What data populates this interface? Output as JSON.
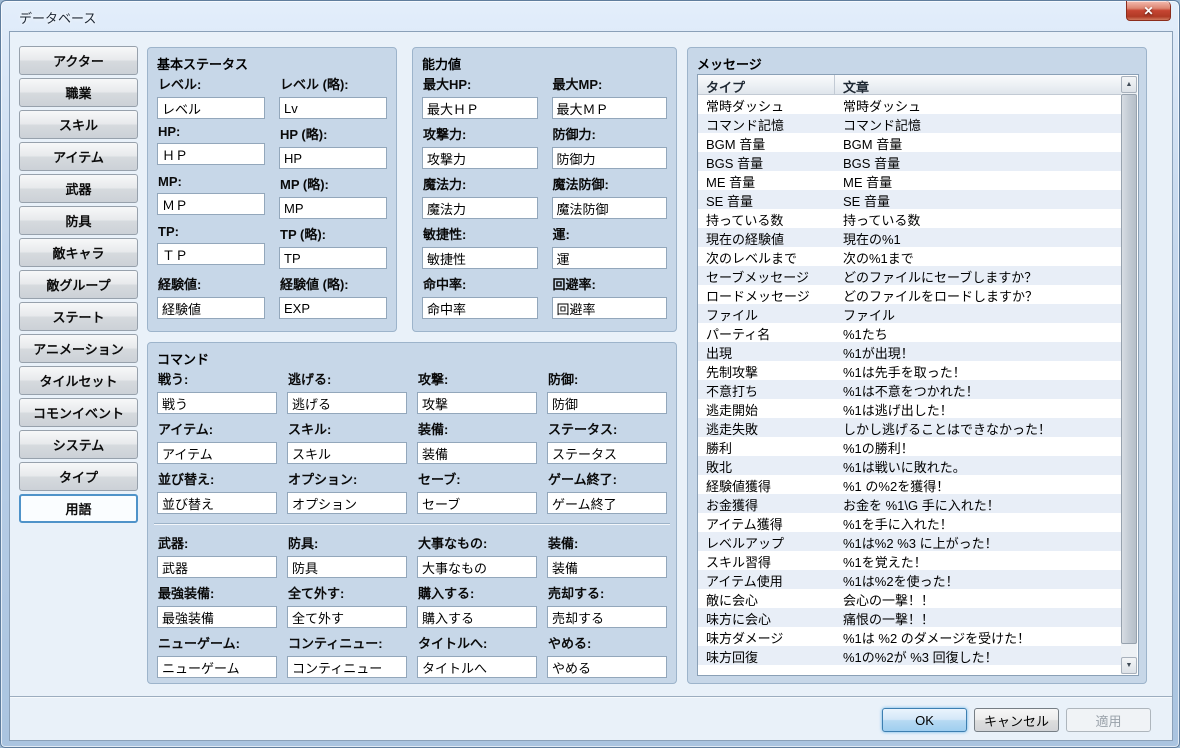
{
  "colors": {
    "titlebar_glass": "#cbdcf0",
    "client_bg": "#e9f1f9",
    "panel_bg": "#c7d7e8",
    "row_alt_bg": "#e8eef7",
    "selected_tab_border": "#4f93c9",
    "close_button_red": "#c64532",
    "ok_button_blue": "#b7daf3"
  },
  "window": {
    "title": "データベース",
    "close_glyph": "✕"
  },
  "icons": {
    "scroll_up": "▲",
    "scroll_down": "▼"
  },
  "sidebar": {
    "selected": "terms",
    "items": [
      {
        "id": "actors",
        "label": "アクター"
      },
      {
        "id": "classes",
        "label": "職業"
      },
      {
        "id": "skills",
        "label": "スキル"
      },
      {
        "id": "items",
        "label": "アイテム"
      },
      {
        "id": "weapons",
        "label": "武器"
      },
      {
        "id": "armors",
        "label": "防具"
      },
      {
        "id": "enemies",
        "label": "敵キャラ"
      },
      {
        "id": "troops",
        "label": "敵グループ"
      },
      {
        "id": "states",
        "label": "ステート"
      },
      {
        "id": "animations",
        "label": "アニメーション"
      },
      {
        "id": "tilesets",
        "label": "タイルセット"
      },
      {
        "id": "common-events",
        "label": "コモンイベント"
      },
      {
        "id": "system",
        "label": "システム"
      },
      {
        "id": "types",
        "label": "タイプ"
      },
      {
        "id": "terms",
        "label": "用語"
      }
    ]
  },
  "sections": {
    "basic_status": {
      "title": "基本ステータス",
      "fields": [
        {
          "id": "level",
          "label": "レベル:",
          "value": "レベル"
        },
        {
          "id": "level-short",
          "label": "レベル (略):",
          "value": "Lv"
        },
        {
          "id": "hp",
          "label": "HP:",
          "value": "ＨＰ"
        },
        {
          "id": "hp-short",
          "label": "HP (略):",
          "value": "HP"
        },
        {
          "id": "mp",
          "label": "MP:",
          "value": "ＭＰ"
        },
        {
          "id": "mp-short",
          "label": "MP (略):",
          "value": "MP"
        },
        {
          "id": "tp",
          "label": "TP:",
          "value": "ＴＰ"
        },
        {
          "id": "tp-short",
          "label": "TP (略):",
          "value": "TP"
        },
        {
          "id": "exp",
          "label": "経験値:",
          "value": "経験値"
        },
        {
          "id": "exp-short",
          "label": "経験値 (略):",
          "value": "EXP"
        }
      ]
    },
    "parameters": {
      "title": "能力値",
      "fields": [
        {
          "id": "max-hp",
          "label": "最大HP:",
          "value": "最大ＨＰ"
        },
        {
          "id": "max-mp",
          "label": "最大MP:",
          "value": "最大ＭＰ"
        },
        {
          "id": "attack",
          "label": "攻撃力:",
          "value": "攻撃力"
        },
        {
          "id": "defense",
          "label": "防御力:",
          "value": "防御力"
        },
        {
          "id": "magic-attack",
          "label": "魔法力:",
          "value": "魔法力"
        },
        {
          "id": "magic-defense",
          "label": "魔法防御:",
          "value": "魔法防御"
        },
        {
          "id": "agility",
          "label": "敏捷性:",
          "value": "敏捷性"
        },
        {
          "id": "luck",
          "label": "運:",
          "value": "運"
        },
        {
          "id": "hit-rate",
          "label": "命中率:",
          "value": "命中率"
        },
        {
          "id": "evasion-rate",
          "label": "回避率:",
          "value": "回避率"
        }
      ]
    },
    "commands": {
      "title": "コマンド",
      "group1": [
        {
          "id": "fight",
          "label": "戦う:",
          "value": "戦う"
        },
        {
          "id": "escape",
          "label": "逃げる:",
          "value": "逃げる"
        },
        {
          "id": "attack",
          "label": "攻撃:",
          "value": "攻撃"
        },
        {
          "id": "guard",
          "label": "防御:",
          "value": "防御"
        },
        {
          "id": "item",
          "label": "アイテム:",
          "value": "アイテム"
        },
        {
          "id": "skill",
          "label": "スキル:",
          "value": "スキル"
        },
        {
          "id": "equip",
          "label": "装備:",
          "value": "装備"
        },
        {
          "id": "status",
          "label": "ステータス:",
          "value": "ステータス"
        },
        {
          "id": "sort",
          "label": "並び替え:",
          "value": "並び替え"
        },
        {
          "id": "options",
          "label": "オプション:",
          "value": "オプション"
        },
        {
          "id": "save",
          "label": "セーブ:",
          "value": "セーブ"
        },
        {
          "id": "game-end",
          "label": "ゲーム終了:",
          "value": "ゲーム終了"
        }
      ],
      "group2": [
        {
          "id": "weapon",
          "label": "武器:",
          "value": "武器"
        },
        {
          "id": "armor",
          "label": "防具:",
          "value": "防具"
        },
        {
          "id": "key-item",
          "label": "大事なもの:",
          "value": "大事なもの"
        },
        {
          "id": "equip2",
          "label": "装備:",
          "value": "装備"
        },
        {
          "id": "optimize",
          "label": "最強装備:",
          "value": "最強装備"
        },
        {
          "id": "clear-all",
          "label": "全て外す:",
          "value": "全て外す"
        },
        {
          "id": "buy",
          "label": "購入する:",
          "value": "購入する"
        },
        {
          "id": "sell",
          "label": "売却する:",
          "value": "売却する"
        },
        {
          "id": "new-game",
          "label": "ニューゲーム:",
          "value": "ニューゲーム"
        },
        {
          "id": "continue",
          "label": "コンティニュー:",
          "value": "コンティニュー"
        },
        {
          "id": "to-title",
          "label": "タイトルへ:",
          "value": "タイトルへ"
        },
        {
          "id": "cancel",
          "label": "やめる:",
          "value": "やめる"
        }
      ]
    },
    "messages": {
      "title": "メッセージ",
      "columns": [
        "タイプ",
        "文章"
      ],
      "rows": [
        [
          "常時ダッシュ",
          "常時ダッシュ"
        ],
        [
          "コマンド記憶",
          "コマンド記憶"
        ],
        [
          "BGM 音量",
          "BGM 音量"
        ],
        [
          "BGS 音量",
          "BGS 音量"
        ],
        [
          "ME 音量",
          "ME 音量"
        ],
        [
          "SE 音量",
          "SE 音量"
        ],
        [
          "持っている数",
          "持っている数"
        ],
        [
          "現在の経験値",
          "現在の%1"
        ],
        [
          "次のレベルまで",
          "次の%1まで"
        ],
        [
          "セーブメッセージ",
          "どのファイルにセーブしますか？"
        ],
        [
          "ロードメッセージ",
          "どのファイルをロードしますか？"
        ],
        [
          "ファイル",
          "ファイル"
        ],
        [
          "パーティ名",
          "%1たち"
        ],
        [
          "出現",
          "%1が出現！"
        ],
        [
          "先制攻撃",
          "%1は先手を取った！"
        ],
        [
          "不意打ち",
          "%1は不意をつかれた！"
        ],
        [
          "逃走開始",
          "%1は逃げ出した！"
        ],
        [
          "逃走失敗",
          "しかし逃げることはできなかった！"
        ],
        [
          "勝利",
          "%1の勝利！"
        ],
        [
          "敗北",
          "%1は戦いに敗れた。"
        ],
        [
          "経験値獲得",
          "%1 の%2を獲得！"
        ],
        [
          "お金獲得",
          "お金を %1\\G 手に入れた！"
        ],
        [
          "アイテム獲得",
          "%1を手に入れた！"
        ],
        [
          "レベルアップ",
          "%1は%2 %3 に上がった！"
        ],
        [
          "スキル習得",
          "%1を覚えた！"
        ],
        [
          "アイテム使用",
          "%1は%2を使った！"
        ],
        [
          "敵に会心",
          "会心の一撃！！"
        ],
        [
          "味方に会心",
          "痛恨の一撃！！"
        ],
        [
          "味方ダメージ",
          "%1は %2 のダメージを受けた！"
        ],
        [
          "味方回復",
          "%1の%2が %3 回復した！"
        ]
      ]
    }
  },
  "footer": {
    "ok": "OK",
    "cancel": "キャンセル",
    "apply": "適用"
  }
}
